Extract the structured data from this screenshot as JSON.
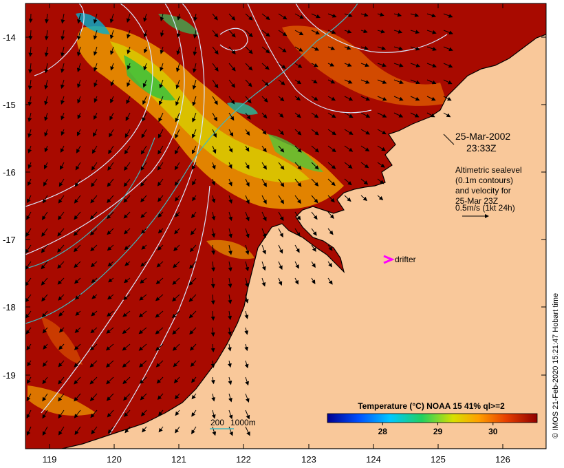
{
  "map": {
    "date": "25-Mar-2002",
    "time": "23:33Z",
    "legend_lines": [
      "Altimetric sealevel",
      "(0.1m contours)",
      "and velocity for",
      "25-Mar 23Z",
      "0.5m/s (1kt 24h)"
    ],
    "drifter_label": "drifter",
    "depth_label_200": "200",
    "depth_label_1000": "1000m",
    "credit": "© IMOS 21-Feb-2020 15:21:47 Hobart time",
    "colorbar": {
      "title": "Temperature (°C) NOAA 15 41% ql>=2",
      "ticks": [
        "28",
        "29",
        "30"
      ],
      "tick_values": [
        28,
        29,
        30
      ],
      "range": [
        27.0,
        30.8
      ]
    },
    "lat_ticks": [
      "-14",
      "-15",
      "-16",
      "-17",
      "-18",
      "-19"
    ],
    "lon_ticks": [
      "119",
      "120",
      "121",
      "122",
      "123",
      "124",
      "125",
      "126"
    ],
    "colors": {
      "land": "#f9c89a",
      "warm_sst": "#a80a00",
      "contour": "#d8e8ff",
      "isobath": "#40b8c0",
      "drifter": "#ff00ff"
    }
  }
}
